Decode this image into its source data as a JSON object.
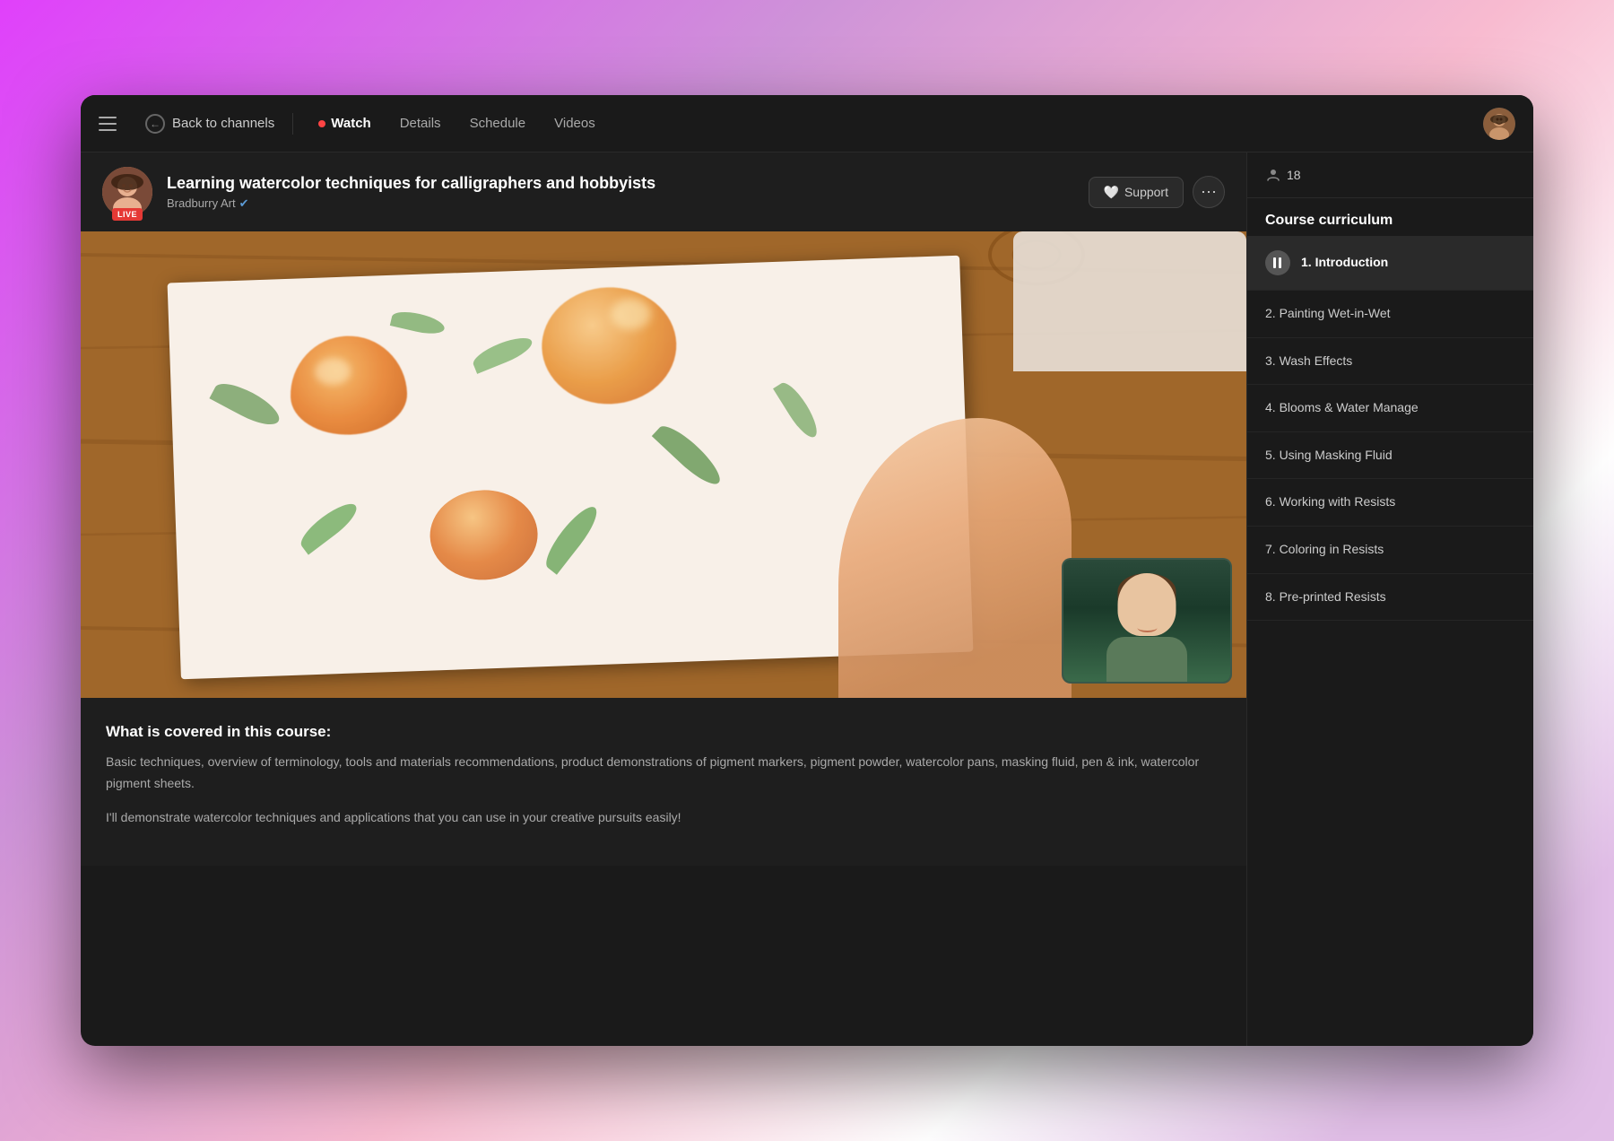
{
  "app": {
    "title": "Learning watercolor techniques"
  },
  "topnav": {
    "back_label": "Back to channels",
    "watch_label": "Watch",
    "details_label": "Details",
    "schedule_label": "Schedule",
    "videos_label": "Videos",
    "viewer_count": "18"
  },
  "channel": {
    "title": "Learning watercolor techniques for calligraphers and hobbyists",
    "author": "Bradburry Art",
    "support_label": "Support",
    "live_label": "LIVE"
  },
  "description": {
    "heading": "What is covered in this course:",
    "text1": "Basic techniques, overview of terminology, tools and materials recommendations,  product demonstrations of pigment markers, pigment powder, watercolor pans, masking fluid, pen & ink, watercolor pigment sheets.",
    "text2": "I'll demonstrate watercolor techniques and applications that you can use in your creative pursuits easily!"
  },
  "curriculum": {
    "title": "Course curriculum",
    "items": [
      {
        "id": 1,
        "label": "1. Introduction",
        "active": true
      },
      {
        "id": 2,
        "label": "2. Painting Wet-in-Wet",
        "active": false
      },
      {
        "id": 3,
        "label": "3. Wash Effects",
        "active": false
      },
      {
        "id": 4,
        "label": "4. Blooms & Water Manage",
        "active": false
      },
      {
        "id": 5,
        "label": "5. Using Masking Fluid",
        "active": false
      },
      {
        "id": 6,
        "label": "6. Working with Resists",
        "active": false
      },
      {
        "id": 7,
        "label": "7. Coloring in Resists",
        "active": false
      },
      {
        "id": 8,
        "label": "8. Pre-printed Resists",
        "active": false
      }
    ]
  }
}
